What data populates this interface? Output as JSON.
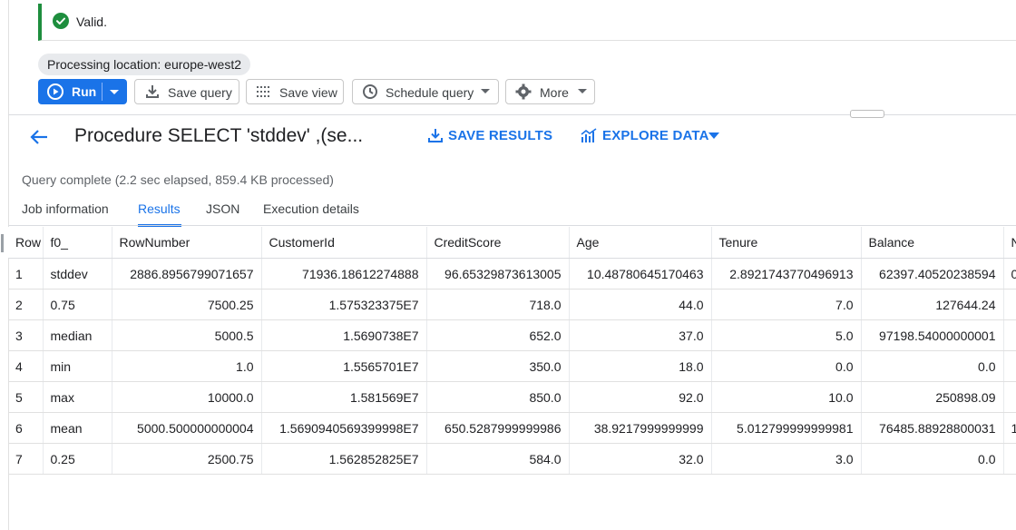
{
  "validation": {
    "text": "Valid."
  },
  "processing_location": "Processing location: europe-west2",
  "toolbar": {
    "run_label": "Run",
    "save_query_label": "Save query",
    "save_view_label": "Save view",
    "schedule_query_label": "Schedule query",
    "more_label": "More"
  },
  "results_header": {
    "title": "Procedure SELECT 'stddev' ,(se...",
    "save_results_label": "SAVE RESULTS",
    "explore_data_label": "EXPLORE DATA"
  },
  "status_text": "Query complete (2.2 sec elapsed, 859.4 KB processed)",
  "tabs": [
    {
      "label": "Job information",
      "active": false
    },
    {
      "label": "Results",
      "active": true
    },
    {
      "label": "JSON",
      "active": false
    },
    {
      "label": "Execution details",
      "active": false
    }
  ],
  "table": {
    "headers": [
      "Row",
      "f0_",
      "RowNumber",
      "CustomerId",
      "CreditScore",
      "Age",
      "Tenure",
      "Balance",
      "N"
    ],
    "rows": [
      [
        "1",
        "stddev",
        "2886.8956799071657",
        "71936.18612274888",
        "96.65329873613005",
        "10.48780645170463",
        "2.8921743770496913",
        "62397.40520238594",
        "0"
      ],
      [
        "2",
        "0.75",
        "7500.25",
        "1.575323375E7",
        "718.0",
        "44.0",
        "7.0",
        "127644.24",
        ""
      ],
      [
        "3",
        "median",
        "5000.5",
        "1.5690738E7",
        "652.0",
        "37.0",
        "5.0",
        "97198.54000000001",
        ""
      ],
      [
        "4",
        "min",
        "1.0",
        "1.5565701E7",
        "350.0",
        "18.0",
        "0.0",
        "0.0",
        ""
      ],
      [
        "5",
        "max",
        "10000.0",
        "1.581569E7",
        "850.0",
        "92.0",
        "10.0",
        "250898.09",
        ""
      ],
      [
        "6",
        "mean",
        "5000.500000000004",
        "1.5690940569399998E7",
        "650.5287999999986",
        "38.9217999999999",
        "5.012799999999981",
        "76485.88928800031",
        "1"
      ],
      [
        "7",
        "0.25",
        "2500.75",
        "1.562852825E7",
        "584.0",
        "32.0",
        "3.0",
        "0.0",
        ""
      ]
    ]
  },
  "colors": {
    "accent": "#1a73e8",
    "valid_green": "#1e8e3e",
    "chip_bg": "#e8eaed"
  },
  "icons": [
    "check-circle-icon",
    "play-icon",
    "dropdown-caret-icon",
    "download-icon",
    "grid-dots-icon",
    "clock-icon",
    "gear-icon",
    "back-arrow-icon",
    "chart-icon"
  ]
}
